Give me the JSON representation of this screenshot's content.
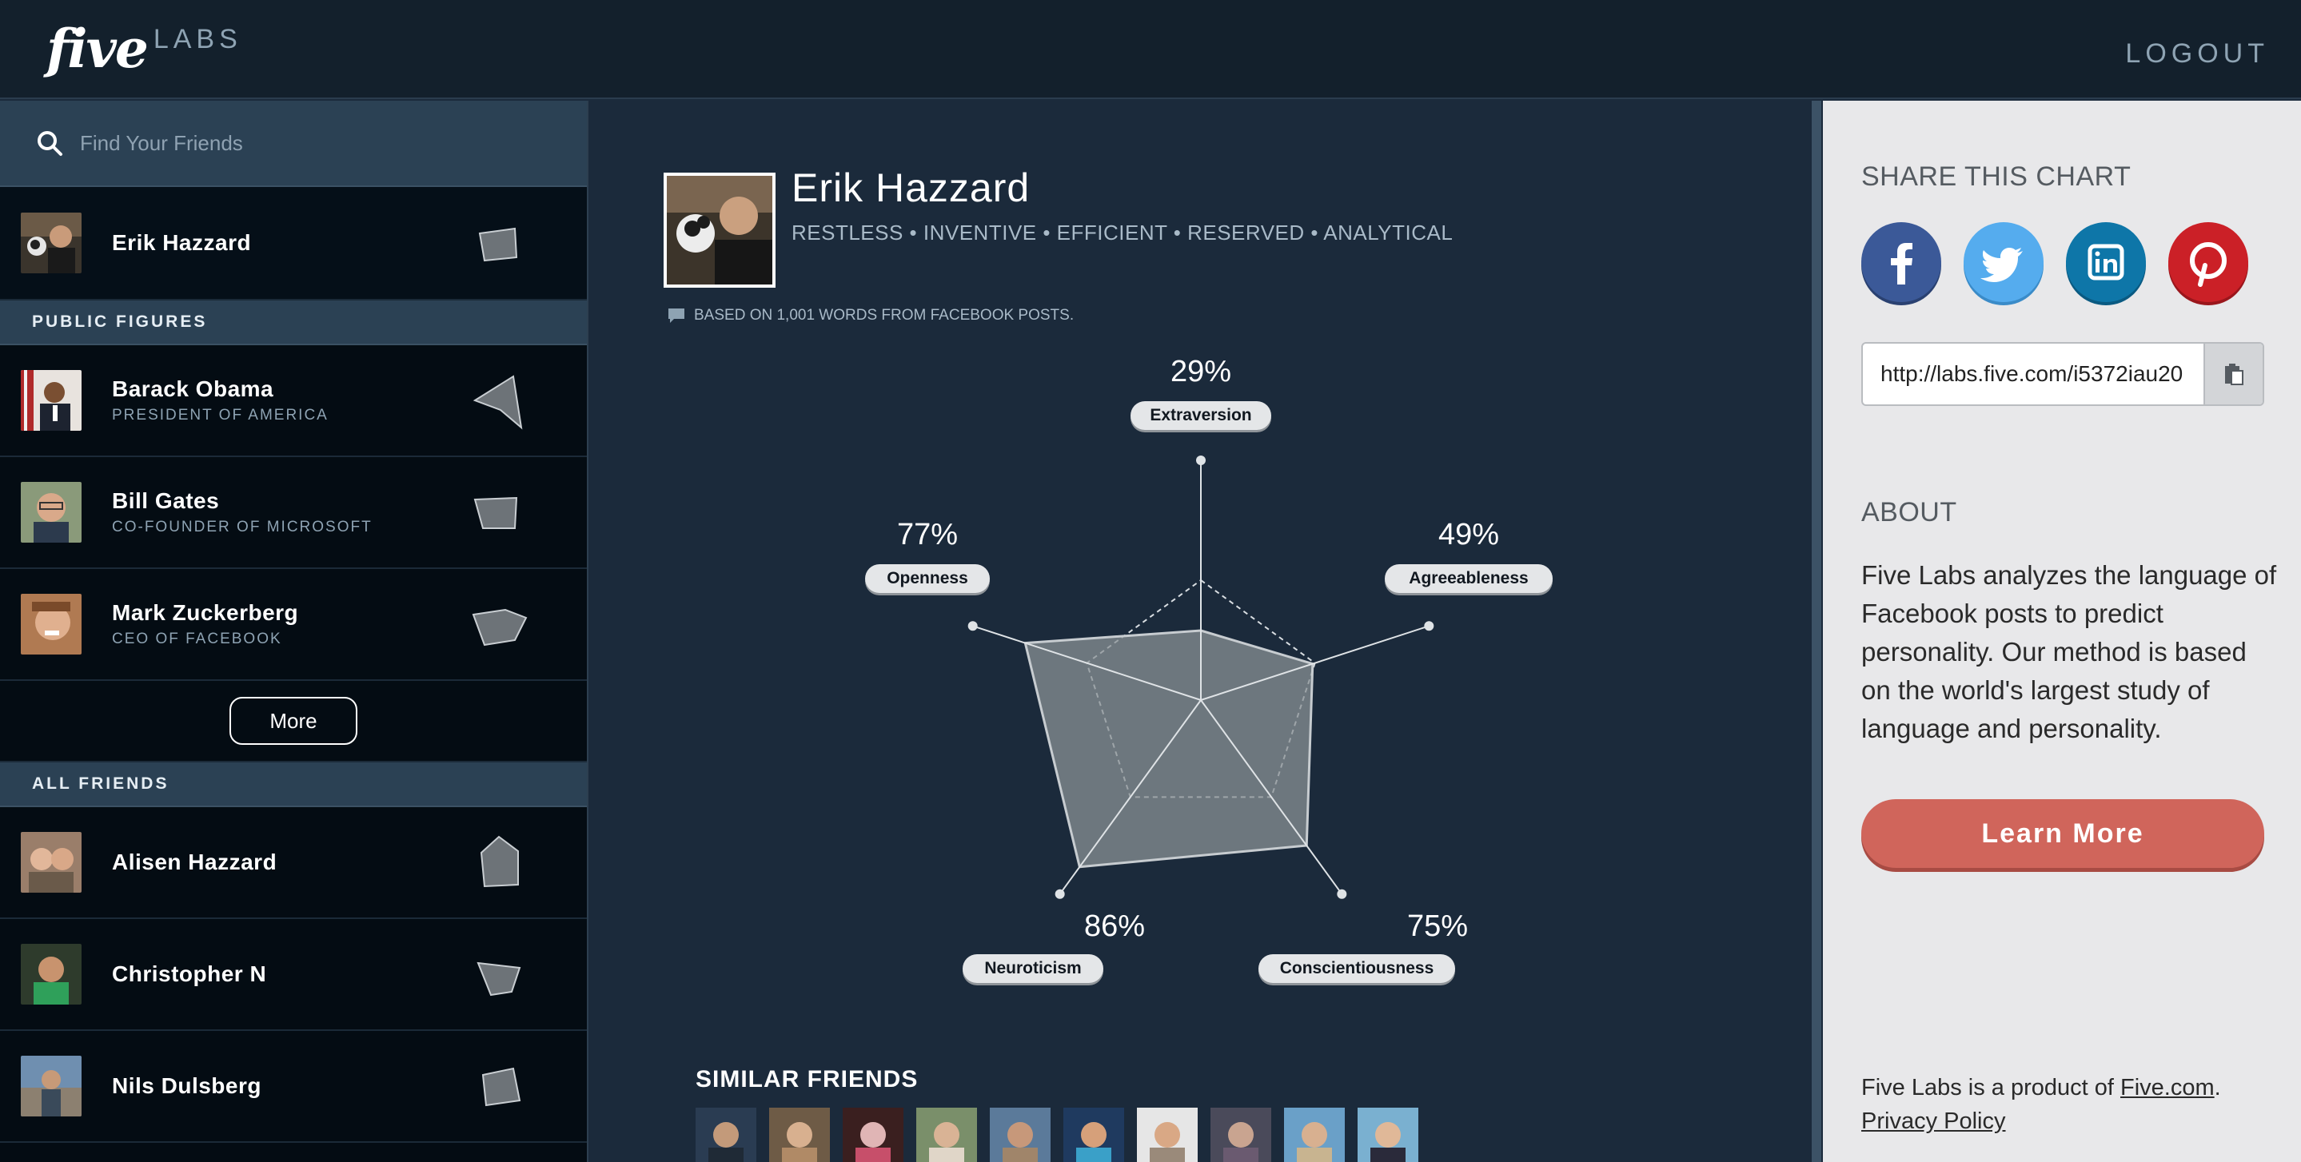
{
  "header": {
    "logo_five": "five",
    "logo_labs": "LABS",
    "logout": "LOGOUT"
  },
  "sidebar": {
    "search_placeholder": "Find Your Friends",
    "me": {
      "name": "Erik Hazzard"
    },
    "public_label": "PUBLIC FIGURES",
    "public": [
      {
        "name": "Barack Obama",
        "sub": "PRESIDENT OF AMERICA"
      },
      {
        "name": "Bill Gates",
        "sub": "CO-FOUNDER OF MICROSOFT"
      },
      {
        "name": "Mark Zuckerberg",
        "sub": "CEO OF FACEBOOK"
      }
    ],
    "more": "More",
    "all_label": "ALL FRIENDS",
    "friends": [
      {
        "name": "Alisen Hazzard"
      },
      {
        "name": "Christopher N"
      },
      {
        "name": "Nils Dulsberg"
      }
    ]
  },
  "profile": {
    "name": "Erik Hazzard",
    "traits": "RESTLESS • INVENTIVE • EFFICIENT • RESERVED • ANALYTICAL",
    "based_on": "BASED ON 1,001 WORDS FROM FACEBOOK POSTS."
  },
  "personality": {
    "traits": [
      {
        "name": "Extraversion",
        "pct": "29%",
        "value": 29
      },
      {
        "name": "Agreeableness",
        "pct": "49%",
        "value": 49
      },
      {
        "name": "Conscientiousness",
        "pct": "75%",
        "value": 75
      },
      {
        "name": "Neuroticism",
        "pct": "86%",
        "value": 86
      },
      {
        "name": "Openness",
        "pct": "77%",
        "value": 77
      }
    ]
  },
  "similar": {
    "title": "SIMILAR FRIENDS",
    "count": 10
  },
  "right": {
    "share_title": "SHARE THIS CHART",
    "url": "http://labs.five.com/i5372iau20",
    "about_title": "ABOUT",
    "about_text": "Five Labs analyzes the language of Facebook posts to predict personality. Our method is based on the world's largest study of language and personality.",
    "learn_more": "Learn More",
    "footer_prefix": "Five Labs is a product of ",
    "footer_link": "Five.com",
    "footer_suffix": ".",
    "privacy": "Privacy Policy"
  },
  "colors": {
    "facebook": "#3b5998",
    "twitter": "#55acee",
    "linkedin": "#0e76a8",
    "pinterest": "#cb2027",
    "learn_more": "#d0655b"
  }
}
